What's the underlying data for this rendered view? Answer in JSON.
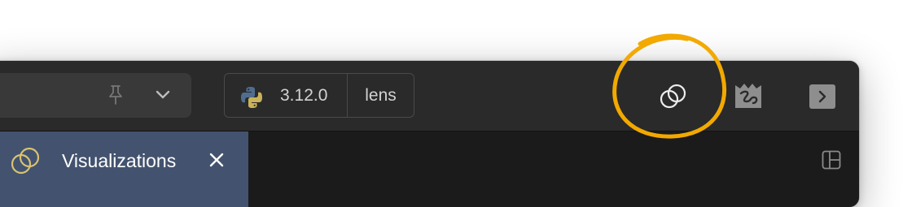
{
  "toolbar": {
    "environment": {
      "python_version": "3.12.0",
      "name": "lens"
    },
    "buttons": {
      "visualizations": "venn-icon",
      "flexibility": "squiggle-icon",
      "expand": "chevron-right-icon"
    }
  },
  "tab": {
    "label": "Visualizations",
    "active_color": "#43536f"
  },
  "annotation": {
    "color": "#f2a900",
    "shape": "hand-drawn circle around visualizations button"
  }
}
